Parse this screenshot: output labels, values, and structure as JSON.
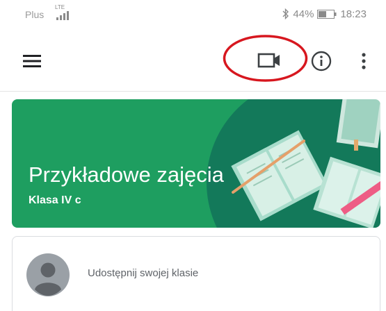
{
  "status_bar": {
    "carrier": "Plus",
    "network_type": "LTE",
    "battery_percent": "44%",
    "time": "18:23",
    "icons": [
      "signal-icon",
      "bluetooth-icon",
      "battery-icon"
    ]
  },
  "app_bar": {
    "icons": [
      "menu-icon",
      "video-camera-icon",
      "info-icon",
      "more-vert-icon"
    ],
    "highlight_color": "#d7171f"
  },
  "class_banner": {
    "name": "Przykładowe zajęcia",
    "section": "Klasa IV c",
    "colors": {
      "background": "#1e9e60",
      "dark_shape": "#13795a",
      "text": "#ffffff"
    }
  },
  "share_card": {
    "prompt": "Udostępnij swojej klasie",
    "icon": "avatar-icon"
  }
}
